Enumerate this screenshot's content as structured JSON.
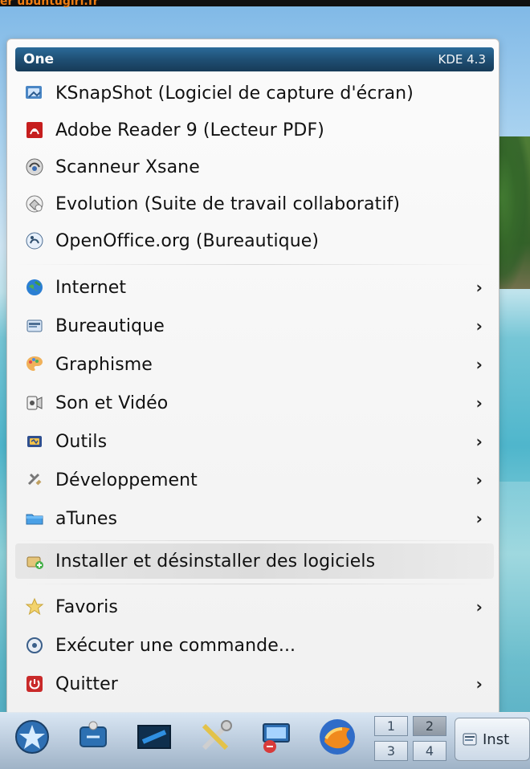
{
  "top_fragment": {
    "text": "er ubuntugirl.fr"
  },
  "menu": {
    "header": {
      "title": "One",
      "version": "KDE 4.3"
    },
    "items": [
      {
        "label": "KSnapShot (Logiciel de capture d'écran)",
        "icon": "ksnapshot-icon",
        "submenu": false
      },
      {
        "label": "Adobe Reader 9 (Lecteur PDF)",
        "icon": "adobe-reader-icon",
        "submenu": false
      },
      {
        "label": "Scanneur Xsane",
        "icon": "scanner-icon",
        "submenu": false
      },
      {
        "label": "Evolution (Suite de travail collaboratif)",
        "icon": "evolution-icon",
        "submenu": false
      },
      {
        "label": "OpenOffice.org (Bureautique)",
        "icon": "openoffice-icon",
        "submenu": false
      },
      {
        "label": "Internet",
        "icon": "internet-globe-icon",
        "submenu": true
      },
      {
        "label": "Bureautique",
        "icon": "office-icon",
        "submenu": true
      },
      {
        "label": "Graphisme",
        "icon": "graphics-palette-icon",
        "submenu": true
      },
      {
        "label": "Son et Vidéo",
        "icon": "multimedia-icon",
        "submenu": true
      },
      {
        "label": "Outils",
        "icon": "tools-icon",
        "submenu": true
      },
      {
        "label": "Développement",
        "icon": "development-icon",
        "submenu": true
      },
      {
        "label": "aTunes",
        "icon": "folder-icon",
        "submenu": true
      },
      {
        "label": "Installer et désinstaller des logiciels",
        "icon": "installer-icon",
        "submenu": false,
        "highlighted": true
      },
      {
        "label": "Favoris",
        "icon": "star-icon",
        "submenu": true
      },
      {
        "label": "Exécuter une commande...",
        "icon": "run-command-icon",
        "submenu": false
      },
      {
        "label": "Quitter",
        "icon": "power-icon",
        "submenu": true
      }
    ],
    "chevron": "›"
  },
  "taskbar": {
    "pager": [
      "1",
      "2",
      "3",
      "4"
    ],
    "active_desktop": "2",
    "task_label": "Inst"
  }
}
